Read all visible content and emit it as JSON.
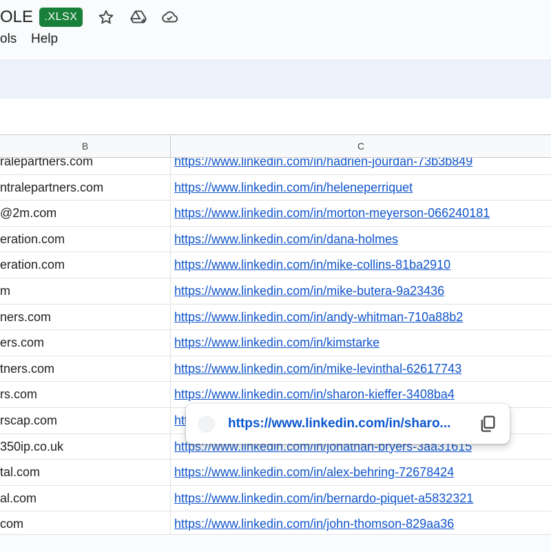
{
  "header": {
    "doc_title_fragment": "OLE",
    "format_badge": ".XLSX",
    "icons": [
      "star-icon",
      "move-to-drive-icon",
      "cloud-status-icon"
    ],
    "menu": [
      {
        "label": "ols"
      },
      {
        "label": "Help"
      }
    ]
  },
  "columns": [
    "B",
    "C"
  ],
  "rows": [
    {
      "b": "ralepartners.com",
      "c": "https://www.linkedin.com/in/hadrien-jourdan-73b3b849"
    },
    {
      "b": "ntralepartners.com",
      "c": "https://www.linkedin.com/in/heleneperriquet"
    },
    {
      "b": "@2m.com",
      "c": "https://www.linkedin.com/in/morton-meyerson-066240181"
    },
    {
      "b": "eration.com",
      "c": "https://www.linkedin.com/in/dana-holmes"
    },
    {
      "b": "eration.com",
      "c": "https://www.linkedin.com/in/mike-collins-81ba2910"
    },
    {
      "b": "m",
      "c": "https://www.linkedin.com/in/mike-butera-9a23436"
    },
    {
      "b": "ners.com",
      "c": "https://www.linkedin.com/in/andy-whitman-710a88b2"
    },
    {
      "b": "ers.com",
      "c": "https://www.linkedin.com/in/kimstarke"
    },
    {
      "b": "tners.com",
      "c": "https://www.linkedin.com/in/mike-levinthal-62617743"
    },
    {
      "b": "rs.com",
      "c": "https://www.linkedin.com/in/sharon-kieffer-3408ba4"
    },
    {
      "b": "rscap.com",
      "c": "https://www.linkedin.com/in/"
    },
    {
      "b": "350ip.co.uk",
      "c": "https://www.linkedin.com/in/jonathan-bryers-3aa31615"
    },
    {
      "b": "tal.com",
      "c": "https://www.linkedin.com/in/alex-behring-72678424"
    },
    {
      "b": "al.com",
      "c": "https://www.linkedin.com/in/bernardo-piquet-a5832321"
    },
    {
      "b": "com",
      "c": "https://www.linkedin.com/in/john-thomson-829aa36"
    }
  ],
  "link_popup": {
    "url": "https://www.linkedin.com/in/sharo...",
    "copy_icon": "copy-icon"
  },
  "colors": {
    "link": "#1155cc",
    "badge": "#188038",
    "popup_url": "#0b57d0"
  }
}
